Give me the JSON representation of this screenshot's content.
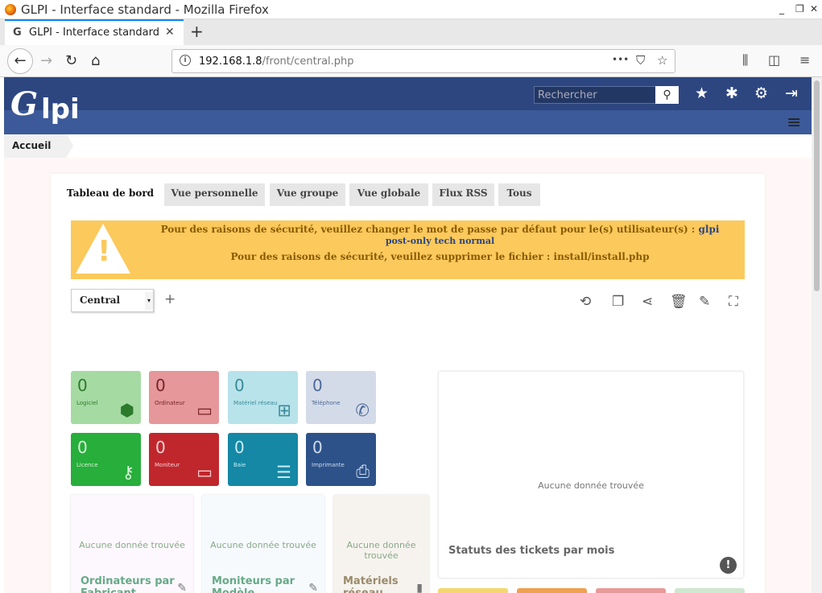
{
  "window": {
    "title": "GLPI - Interface standard - Mozilla Firefox",
    "controls": {
      "minimize": "_",
      "maximize": "❐",
      "close": "✕"
    }
  },
  "browser": {
    "tab_title": "GLPI - Interface standard",
    "tab_icon": "G",
    "tab_close": "✕",
    "new_tab": "+",
    "url_host": "192.168.1.8",
    "url_path": "/front/central.php",
    "url_info": "i",
    "url_actions": {
      "more": "•••",
      "pocket": "⛉",
      "bookmark": "☆"
    },
    "nav": {
      "back": "←",
      "forward": "→",
      "reload": "↻",
      "home": "⌂"
    },
    "toolbar": {
      "library": "⫼",
      "sidebar": "◫",
      "menu": "≡"
    }
  },
  "app": {
    "logo": {
      "g": "G",
      "lpi": "lpi"
    },
    "search": {
      "placeholder": "Rechercher",
      "button": "⚲"
    },
    "header_icons": {
      "star": "★",
      "bug": "✱",
      "gear": "⚙",
      "logout": "⇥"
    },
    "menu_icon": "≡",
    "breadcrumb": "Accueil"
  },
  "tabs": [
    "Tableau de bord",
    "Vue personnelle",
    "Vue groupe",
    "Vue globale",
    "Flux RSS",
    "Tous"
  ],
  "alert": {
    "icon": "!",
    "line1": "Pour des raisons de sécurité, veuillez changer le mot de passe par défaut pour le(s) utilisateur(s) :",
    "users": [
      "glpi",
      "post-only",
      "tech",
      "normal"
    ],
    "line2": "Pour des raisons de sécurité, veuillez supprimer le fichier : install/install.php"
  },
  "dashboard": {
    "selected": "Central",
    "caret": "▾",
    "add": "+",
    "tools": {
      "history": "⟲",
      "clone": "❐",
      "share": "⋖",
      "delete": "🗑",
      "edit": "✎",
      "fullscreen": "⛶"
    }
  },
  "cards": [
    {
      "value": "0",
      "label": "Logiciel",
      "icon": "⬢",
      "bg": "#a5dba2",
      "fg": "#2c7a2c"
    },
    {
      "value": "0",
      "label": "Ordinateur",
      "icon": "▭",
      "bg": "#e5979a",
      "fg": "#7a2328"
    },
    {
      "value": "0",
      "label": "Matériel réseau",
      "icon": "⊞",
      "bg": "#b8e3ea",
      "fg": "#3a8a9a"
    },
    {
      "value": "0",
      "label": "Téléphone",
      "icon": "✆",
      "bg": "#d4dbe8",
      "fg": "#4a6a9a"
    },
    {
      "value": "0",
      "label": "Licence",
      "icon": "⚷",
      "bg": "#27ae3b",
      "fg": "#d8f4da"
    },
    {
      "value": "0",
      "label": "Moniteur",
      "icon": "▭",
      "bg": "#c0272d",
      "fg": "#f7d4d5"
    },
    {
      "value": "0",
      "label": "Baie",
      "icon": "☰",
      "bg": "#1488a5",
      "fg": "#c8ecf5"
    },
    {
      "value": "0",
      "label": "Imprimante",
      "icon": "⎙",
      "bg": "#2d5289",
      "fg": "#d0dcef"
    }
  ],
  "mini_widgets": [
    {
      "empty": "Aucune donnée trouvée",
      "title": "Ordinateurs par Fabricant",
      "icon": "✎",
      "bg": "#fdf8fd"
    },
    {
      "empty": "Aucune donnée trouvée",
      "title": "Moniteurs par Modèle",
      "icon": "✎",
      "bg": "#f6fafd"
    },
    {
      "empty": "Aucune donnée trouvée",
      "title": "Matériels réseau",
      "icon": "▮",
      "bg": "#f6f3ee"
    }
  ],
  "big_widget": {
    "empty": "Aucune donnée trouvée",
    "title": "Statuts des tickets par mois",
    "warn": "!"
  },
  "stub_colors": [
    "#f5d76e",
    "#f0a050",
    "#e89a98",
    "#cfe6cf"
  ]
}
